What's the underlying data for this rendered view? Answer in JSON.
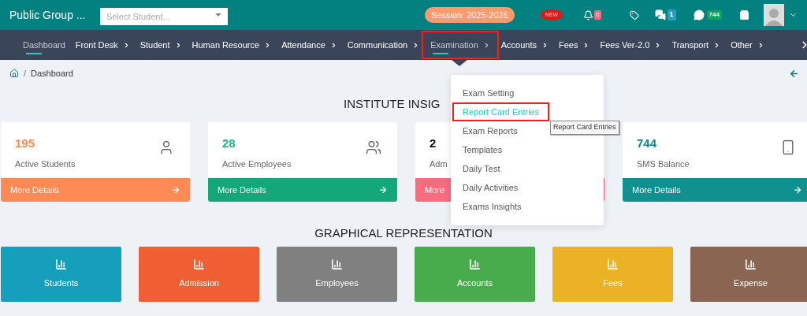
{
  "header": {
    "title": "Public Group ...",
    "student_select": {
      "placeholder": "Select Student..."
    },
    "session": "Session: 2025-2026",
    "new_badge": "NEW",
    "notifications": "0",
    "chats": "1",
    "sms": "744"
  },
  "nav": [
    {
      "label": "Dashboard",
      "selected": true,
      "has_submenu": false,
      "highlighted": false
    },
    {
      "label": "Front Desk",
      "selected": false,
      "has_submenu": true,
      "highlighted": false
    },
    {
      "label": "Student",
      "selected": false,
      "has_submenu": true,
      "highlighted": false
    },
    {
      "label": "Human Resource",
      "selected": false,
      "has_submenu": true,
      "highlighted": false
    },
    {
      "label": "Attendance",
      "selected": false,
      "has_submenu": true,
      "highlighted": false
    },
    {
      "label": "Communication",
      "selected": false,
      "has_submenu": true,
      "highlighted": false
    },
    {
      "label": "Examination",
      "selected": true,
      "has_submenu": true,
      "highlighted": true
    },
    {
      "label": "Accounts",
      "selected": false,
      "has_submenu": true,
      "highlighted": false
    },
    {
      "label": "Fees",
      "selected": false,
      "has_submenu": true,
      "highlighted": false
    },
    {
      "label": "Fees Ver-2.0",
      "selected": false,
      "has_submenu": true,
      "highlighted": false
    },
    {
      "label": "Transport",
      "selected": false,
      "has_submenu": true,
      "highlighted": false
    },
    {
      "label": "Other",
      "selected": false,
      "has_submenu": true,
      "highlighted": false
    }
  ],
  "breadcrumb": {
    "separator": "/",
    "items": [
      "Dashboard"
    ]
  },
  "insights": {
    "title": "INSTITUTE INSIG",
    "cards": [
      {
        "value": "195",
        "label": "Active Students",
        "link": "More Details",
        "kind": "students"
      },
      {
        "value": "28",
        "label": "Active Employees",
        "link": "More Details",
        "kind": "employees"
      },
      {
        "value": "2",
        "label": "Adm",
        "link": "More",
        "kind": "admissions"
      },
      {
        "value": "744",
        "label": "SMS Balance",
        "link": "More Details",
        "kind": "sms"
      }
    ]
  },
  "exam_menu": {
    "items": [
      {
        "label": "Exam Setting",
        "selected": false,
        "highlighted": false
      },
      {
        "label": "Report Card Entries",
        "selected": true,
        "highlighted": true
      },
      {
        "label": "Exam Reports",
        "selected": false,
        "highlighted": false
      },
      {
        "label": "Templates",
        "selected": false,
        "highlighted": false
      },
      {
        "label": "Daily Test",
        "selected": false,
        "highlighted": false
      },
      {
        "label": "Daily Activities",
        "selected": false,
        "highlighted": false
      },
      {
        "label": "Exams Insights",
        "selected": false,
        "highlighted": false
      }
    ],
    "tooltip": "Report Card Entries"
  },
  "graphical": {
    "title": "GRAPHICAL REPRESENTATION",
    "tiles": [
      {
        "label": "Students",
        "color": "#159fbb"
      },
      {
        "label": "Admission",
        "color": "#f05f33"
      },
      {
        "label": "Employees",
        "color": "#808080"
      },
      {
        "label": "Accounts",
        "color": "#48ac4c"
      },
      {
        "label": "Fees",
        "color": "#ebb225"
      },
      {
        "label": "Expense",
        "color": "#8a6652"
      }
    ]
  }
}
